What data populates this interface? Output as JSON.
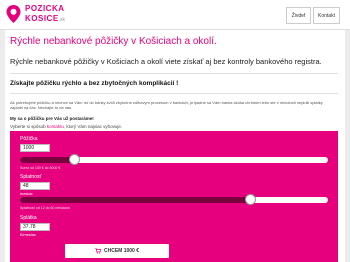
{
  "brand": {
    "name_line1": "POZICKA",
    "name_line2": "KOSICE",
    "name_suffix": ".sk",
    "accent": "#e6007e"
  },
  "nav": {
    "items": [
      {
        "label": "Živdef"
      },
      {
        "label": "Kontakt"
      }
    ]
  },
  "main": {
    "title": "Rýchle nebankové pôžičky v Košiciach a okolí.",
    "intro": "Rýchle nebankové pôžičky v Košiciach a okolí viete získať aj bez kontroly bankového registra.",
    "subtitle": "Získajte pôžičku rýchlo a bez zbytočných komplikácií !",
    "paragraph": "Ak potrebujete pôžičku a nechce sa Vám ísť do banky kvôli zbytočne zdĺhavým procesom v bankách, prípadne sa Vám banka skúša chrlotom lebo ste v minulosti neplnili splátky zaplatit na čas. Nechajte to na nás.",
    "question": "My sa o pôžičku pre Vás už postaráme!",
    "tip_prefix": "Vyberte si spôsob",
    "tip_link": "kontaktu,",
    "tip_suffix": "ktorý Vám najviac vyhovuje."
  },
  "calculator": {
    "loan_label": "Pôžička",
    "loan_value": "1000",
    "loan_range": "Suma od 100 € do 5000 €",
    "loan_fraction": 0.18,
    "term_label": "Splatnosť",
    "term_value": "48",
    "term_unit": "mesiac",
    "term_range": "Splatnosť od 12 do 60 mesiacov",
    "term_fraction": 0.75,
    "installment_label": "Splátka",
    "installment_value": "37.78",
    "installment_unit": "€/mesiac",
    "cta_label": "CHCEM 1000 €"
  },
  "icons": {
    "logo": "pin-icon",
    "cta": "cart-icon"
  }
}
